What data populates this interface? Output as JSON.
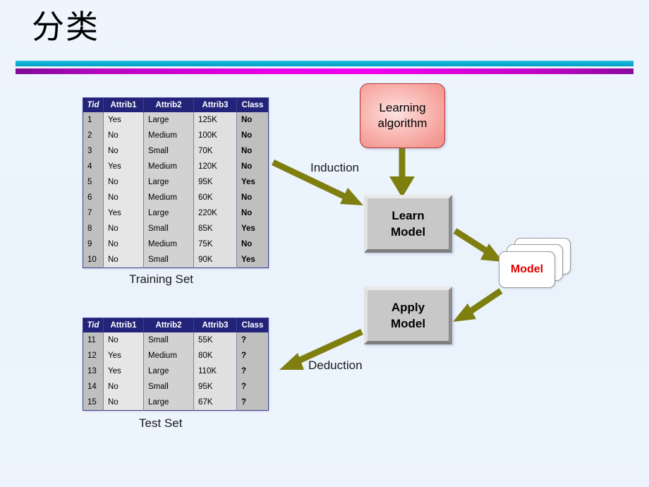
{
  "slide": {
    "title": "分类",
    "background_color": "#eaf3fc",
    "divider_cyan_color": "#0aa8cd",
    "divider_magenta_color": "#e900e9"
  },
  "tables": {
    "columns": [
      "Tid",
      "Attrib1",
      "Attrib2",
      "Attrib3",
      "Class"
    ],
    "header_bg": "#23237a",
    "header_text_color": "#ffffff",
    "class_text_color": "#e00000",
    "training": {
      "caption": "Training Set",
      "rows": [
        {
          "tid": "1",
          "attrib1": "Yes",
          "attrib2": "Large",
          "attrib3": "125K",
          "class": "No"
        },
        {
          "tid": "2",
          "attrib1": "No",
          "attrib2": "Medium",
          "attrib3": "100K",
          "class": "No"
        },
        {
          "tid": "3",
          "attrib1": "No",
          "attrib2": "Small",
          "attrib3": "70K",
          "class": "No"
        },
        {
          "tid": "4",
          "attrib1": "Yes",
          "attrib2": "Medium",
          "attrib3": "120K",
          "class": "No"
        },
        {
          "tid": "5",
          "attrib1": "No",
          "attrib2": "Large",
          "attrib3": "95K",
          "class": "Yes"
        },
        {
          "tid": "6",
          "attrib1": "No",
          "attrib2": "Medium",
          "attrib3": "60K",
          "class": "No"
        },
        {
          "tid": "7",
          "attrib1": "Yes",
          "attrib2": "Large",
          "attrib3": "220K",
          "class": "No"
        },
        {
          "tid": "8",
          "attrib1": "No",
          "attrib2": "Small",
          "attrib3": "85K",
          "class": "Yes"
        },
        {
          "tid": "9",
          "attrib1": "No",
          "attrib2": "Medium",
          "attrib3": "75K",
          "class": "No"
        },
        {
          "tid": "10",
          "attrib1": "No",
          "attrib2": "Small",
          "attrib3": "90K",
          "class": "Yes"
        }
      ]
    },
    "test": {
      "caption": "Test Set",
      "rows": [
        {
          "tid": "11",
          "attrib1": "No",
          "attrib2": "Small",
          "attrib3": "55K",
          "class": "?"
        },
        {
          "tid": "12",
          "attrib1": "Yes",
          "attrib2": "Medium",
          "attrib3": "80K",
          "class": "?"
        },
        {
          "tid": "13",
          "attrib1": "Yes",
          "attrib2": "Large",
          "attrib3": "110K",
          "class": "?"
        },
        {
          "tid": "14",
          "attrib1": "No",
          "attrib2": "Small",
          "attrib3": "95K",
          "class": "?"
        },
        {
          "tid": "15",
          "attrib1": "No",
          "attrib2": "Large",
          "attrib3": "67K",
          "class": "?"
        }
      ]
    }
  },
  "diagram": {
    "learning_algorithm": {
      "line1": "Learning",
      "line2": "algorithm",
      "color": "#f4a8a3"
    },
    "learn_model": {
      "line1": "Learn",
      "line2": "Model"
    },
    "apply_model": {
      "line1": "Apply",
      "line2": "Model"
    },
    "model": {
      "label": "Model",
      "color": "#e00000"
    },
    "arrows": {
      "induction_label": "Induction",
      "deduction_label": "Deduction",
      "color": "#7f7f10"
    }
  }
}
